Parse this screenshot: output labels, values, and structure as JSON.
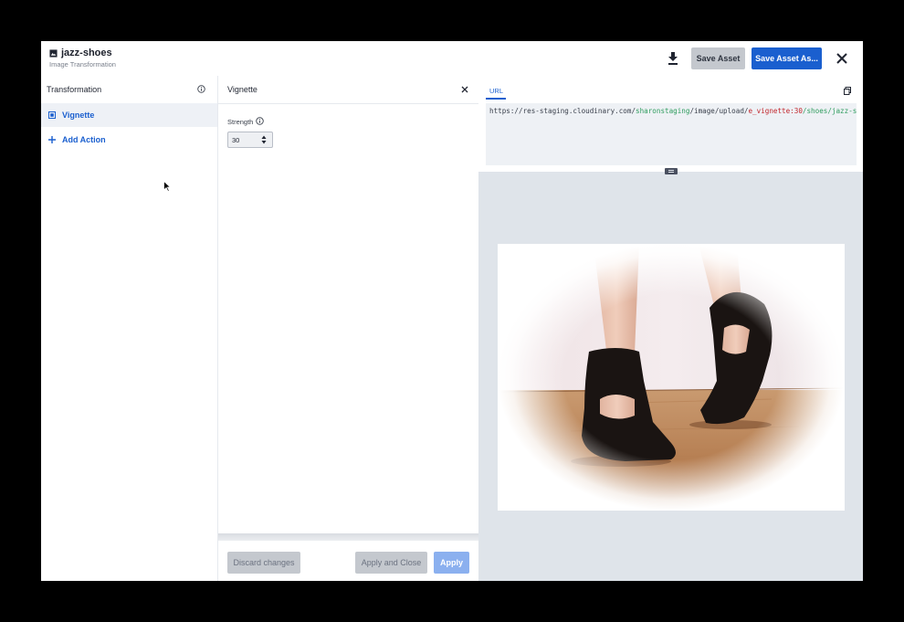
{
  "header": {
    "title": "jazz-shoes",
    "subtitle": "Image Transformation",
    "save_asset": "Save Asset",
    "save_asset_as": "Save Asset As...",
    "icons": [
      "image-icon",
      "download-icon",
      "close-icon"
    ]
  },
  "left_panel": {
    "title": "Transformation",
    "items": [
      {
        "label": "Vignette",
        "selected": true
      }
    ],
    "add_action": "Add Action"
  },
  "middle_panel": {
    "title": "Vignette",
    "field_label": "Strength",
    "field_value": "30",
    "discard": "Discard changes",
    "apply_close": "Apply and Close",
    "apply": "Apply"
  },
  "right_panel": {
    "tab": "URL",
    "url_parts": {
      "base": "https://res-staging.cloudinary.com/",
      "cloud": "sharonstaging",
      "path": "/image/upload/",
      "transformation": "e_vignette:30",
      "sep": "/",
      "asset": "shoes/jazz-sho"
    }
  },
  "colors": {
    "accent": "#1a5fcf",
    "transformation": "#c2272d",
    "cloud_name": "#2e9c5e"
  }
}
